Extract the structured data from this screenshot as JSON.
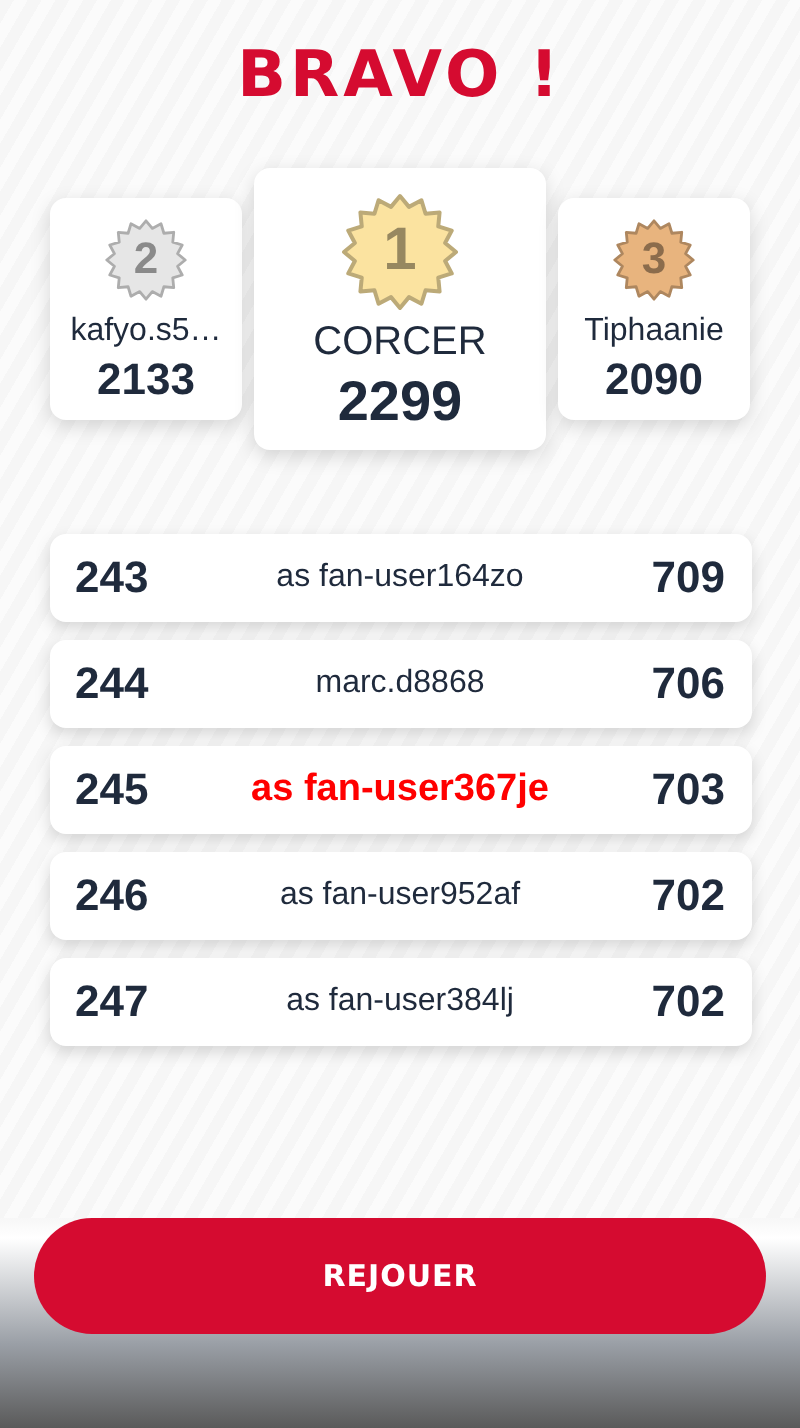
{
  "title": "BRAVO !",
  "podium": [
    {
      "rank": "2",
      "name": "kafyo.s5…",
      "score": "2133",
      "color": "#e6e6e6",
      "kind": "side"
    },
    {
      "rank": "1",
      "name": "CORCER",
      "score": "2299",
      "color": "#fbe3a0",
      "kind": "center"
    },
    {
      "rank": "3",
      "name": "Tiphaanie",
      "score": "2090",
      "color": "#e8b47e",
      "kind": "side"
    }
  ],
  "rows": [
    {
      "rank": "243",
      "name": "as fan-user164zo",
      "score": "709",
      "selected": false
    },
    {
      "rank": "244",
      "name": "marc.d8868",
      "score": "706",
      "selected": false
    },
    {
      "rank": "245",
      "name": "as fan-user367je",
      "score": "703",
      "selected": true
    },
    {
      "rank": "246",
      "name": "as fan-user952af",
      "score": "702",
      "selected": false
    },
    {
      "rank": "247",
      "name": "as fan-user384lj",
      "score": "702",
      "selected": false
    }
  ],
  "button": "REJOUER"
}
